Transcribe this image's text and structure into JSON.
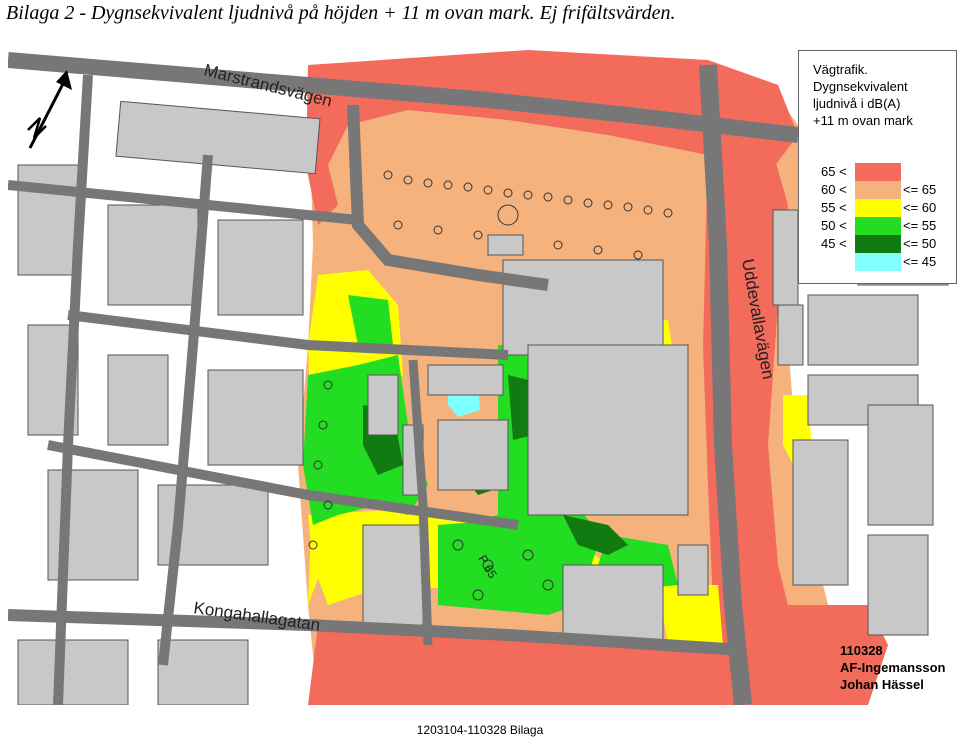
{
  "title": "Bilaga 2 - Dygnsekvivalent ljudnivå på höjden + 11 m ovan mark. Ej frifältsvärden.",
  "streets": {
    "marstrand": "Marstrandsvägen",
    "uddevalla": "Uddevallavägen",
    "kongahalla": "Kongahallagatan",
    "p65": "P 65"
  },
  "legend": {
    "line1": "Vägtrafik.",
    "line2": "Dygnsekvivalent",
    "line3": "ljudnivå i dB(A)",
    "line4": "+11 m ovan mark",
    "classes": [
      {
        "low": "65 <",
        "high": "",
        "color": "#f26b5b"
      },
      {
        "low": "60 <",
        "high": "<= 65",
        "color": "#f6b27c"
      },
      {
        "low": "55 <",
        "high": "<= 60",
        "color": "#ffff00"
      },
      {
        "low": "50 <",
        "high": "<= 55",
        "color": "#22dd22"
      },
      {
        "low": "45 <",
        "high": "<= 50",
        "color": "#117a11"
      },
      {
        "low": "",
        "high": "<= 45",
        "color": "#7fffff"
      }
    ]
  },
  "stamp": {
    "date": "110328",
    "company": "AF-Ingemansson",
    "author": "Johan Hässel"
  },
  "footer": "1203104-110328 Bilaga",
  "colors": {
    "road": "#777777",
    "building": "#c8c8c8",
    "building_edge": "#555555",
    "background": "#ffffff"
  }
}
